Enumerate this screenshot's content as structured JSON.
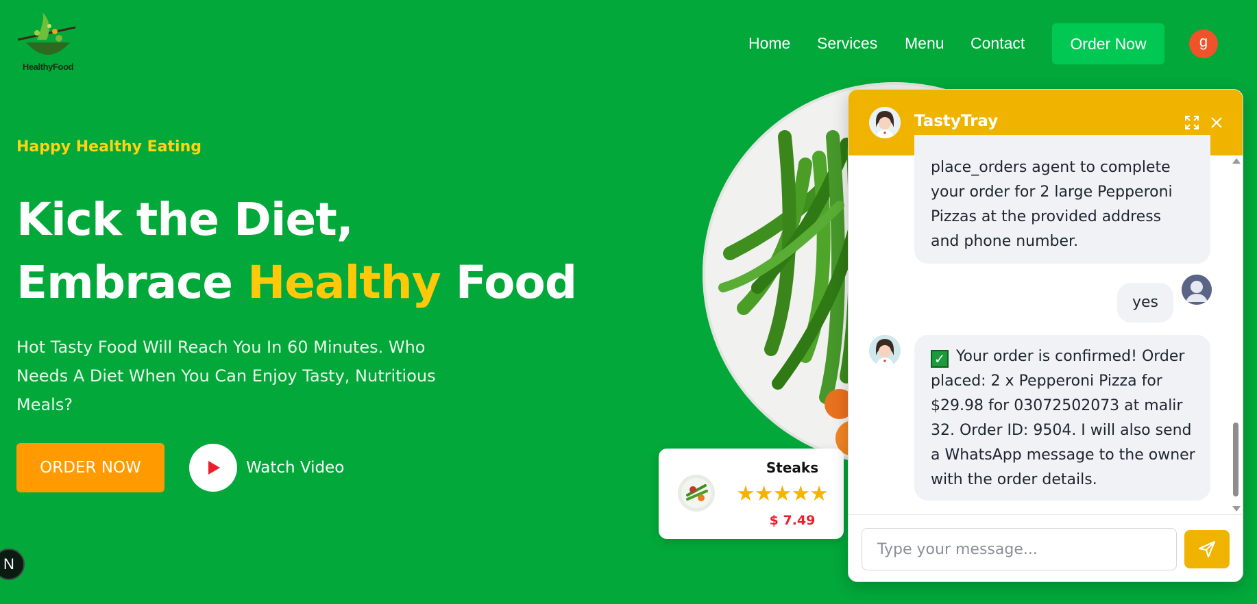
{
  "logo": {
    "text": "HealthyFood"
  },
  "nav": {
    "links": [
      "Home",
      "Services",
      "Menu",
      "Contact"
    ],
    "order_button": "Order Now",
    "user_initial": "g"
  },
  "hero": {
    "tagline": "Happy Healthy Eating",
    "headline_line1": "Kick the Diet,",
    "headline_line2_pre": "Embrace ",
    "headline_line2_highlight": "Healthy",
    "headline_line2_post": " Food",
    "subtext": "Hot Tasty Food Will Reach You In 60 Minutes. Who Needs A Diet When You Can Enjoy Tasty, Nutritious Meals?",
    "cta": "ORDER NOW",
    "watch_video": "Watch Video"
  },
  "corner_badge": "N",
  "food_card": {
    "name": "Steaks",
    "stars": "★★★★★",
    "rating": 5,
    "price": "$ 7.49"
  },
  "chat": {
    "title": "TastyTray",
    "messages": [
      {
        "from": "bot",
        "text": "place_orders agent to complete your order for 2 large Pepperoni Pizzas at the provided address and phone number."
      },
      {
        "from": "user",
        "text": "yes"
      },
      {
        "from": "bot",
        "text": "Your order is confirmed! Order placed: 2 x Pepperoni Pizza for $29.98 for 03072502073 at malir 32. Order ID: 9504. I will also send a WhatsApp message to the owner with the order details."
      }
    ],
    "check_glyph": "✓",
    "input_placeholder": "Type your message..."
  },
  "colors": {
    "background": "#02a83a",
    "accent_yellow": "#ffc90a",
    "cta_orange": "#ff9a00",
    "order_green": "#00c853",
    "chat_header": "#f0b400",
    "price_red": "#ee1d2d"
  },
  "icons": [
    "logo-icon",
    "play-icon",
    "expand-icon",
    "close-icon",
    "send-icon",
    "chef-avatar-icon",
    "user-avatar-icon",
    "check-icon"
  ]
}
